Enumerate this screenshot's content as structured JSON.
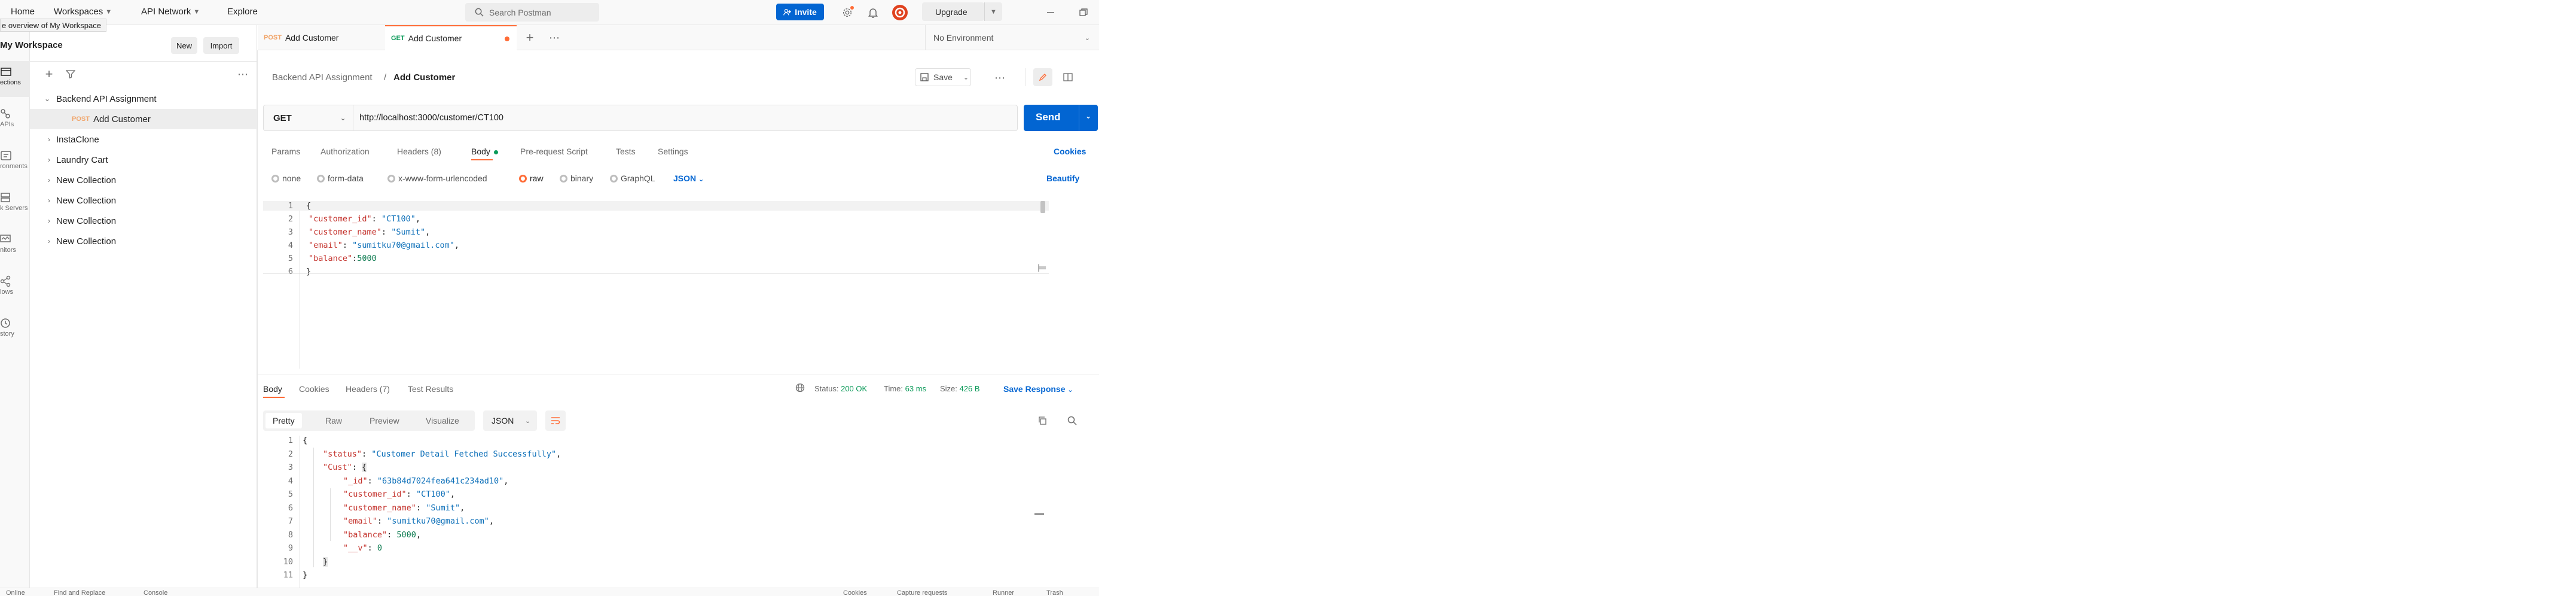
{
  "topbar": {
    "nav": [
      {
        "label": "Home",
        "has_menu": false
      },
      {
        "label": "Workspaces",
        "has_menu": true
      },
      {
        "label": "API Network",
        "has_menu": true
      },
      {
        "label": "Explore",
        "has_menu": false
      }
    ],
    "search_placeholder": "Search Postman",
    "invite_label": "Invite",
    "upgrade_label": "Upgrade",
    "tooltip": "e overview of My Workspace"
  },
  "rail": {
    "items": [
      {
        "label": "ections",
        "icon": "collections-icon",
        "active": true
      },
      {
        "label": "APIs",
        "icon": "apis-icon",
        "active": false
      },
      {
        "label": "ronments",
        "icon": "environments-icon",
        "active": false
      },
      {
        "label": "k Servers",
        "icon": "mock-servers-icon",
        "active": false
      },
      {
        "label": "nitors",
        "icon": "monitors-icon",
        "active": false
      },
      {
        "label": "lows",
        "icon": "flows-icon",
        "active": false
      },
      {
        "label": "story",
        "icon": "history-icon",
        "active": false
      }
    ]
  },
  "sidebar": {
    "workspace_name": "My Workspace",
    "new_label": "New",
    "import_label": "Import",
    "tree": [
      {
        "label": "Backend API Assignment",
        "expanded": true,
        "method": "",
        "selected": false
      },
      {
        "label": "Add Customer",
        "expanded": false,
        "method": "POST",
        "selected": true
      },
      {
        "label": "InstaClone",
        "expanded": false,
        "method": "",
        "selected": false
      },
      {
        "label": "Laundry Cart",
        "expanded": false,
        "method": "",
        "selected": false
      },
      {
        "label": "New Collection",
        "expanded": false,
        "method": "",
        "selected": false
      },
      {
        "label": "New Collection",
        "expanded": false,
        "method": "",
        "selected": false
      },
      {
        "label": "New Collection",
        "expanded": false,
        "method": "",
        "selected": false
      },
      {
        "label": "New Collection",
        "expanded": false,
        "method": "",
        "selected": false
      }
    ]
  },
  "tabs": [
    {
      "method": "POST",
      "label": "Add Customer",
      "active": false
    },
    {
      "method": "GET",
      "label": "Add Customer",
      "active": true
    }
  ],
  "environment": "No Environment",
  "request": {
    "breadcrumb_parent": "Backend API Assignment",
    "breadcrumb_sep": "/",
    "breadcrumb_current": "Add Customer",
    "save_label": "Save",
    "method": "GET",
    "url": "http://localhost:3000/customer/CT100",
    "send_label": "Send",
    "tabs": [
      {
        "label": "Params",
        "active": false
      },
      {
        "label": "Authorization",
        "active": false
      },
      {
        "label": "Headers (8)",
        "active": false
      },
      {
        "label": "Body",
        "active": true
      },
      {
        "label": "Pre-request Script",
        "active": false
      },
      {
        "label": "Tests",
        "active": false
      },
      {
        "label": "Settings",
        "active": false
      }
    ],
    "cookies_label": "Cookies",
    "body_types": [
      {
        "label": "none",
        "selected": false
      },
      {
        "label": "form-data",
        "selected": false
      },
      {
        "label": "x-www-form-urlencoded",
        "selected": false
      },
      {
        "label": "raw",
        "selected": true
      },
      {
        "label": "binary",
        "selected": false
      },
      {
        "label": "GraphQL",
        "selected": false
      }
    ],
    "body_format": "JSON",
    "beautify_label": "Beautify",
    "body_lines": [
      "1",
      "2",
      "3",
      "4",
      "5",
      "6"
    ]
  },
  "response": {
    "tabs": [
      {
        "label": "Body",
        "active": true
      },
      {
        "label": "Cookies",
        "active": false
      },
      {
        "label": "Headers (7)",
        "active": false
      },
      {
        "label": "Test Results",
        "active": false
      }
    ],
    "status_label": "Status:",
    "status_value": "200 OK",
    "time_label": "Time:",
    "time_value": "63 ms",
    "size_label": "Size:",
    "size_value": "426 B",
    "save_response_label": "Save Response",
    "view_modes": [
      {
        "label": "Pretty",
        "active": true
      },
      {
        "label": "Raw",
        "active": false
      },
      {
        "label": "Preview",
        "active": false
      },
      {
        "label": "Visualize",
        "active": false
      }
    ],
    "format": "JSON",
    "lines": [
      "1",
      "2",
      "3",
      "4",
      "5",
      "6",
      "7",
      "8",
      "9",
      "10",
      "11"
    ]
  },
  "statusbar": {
    "online": "Online",
    "console": "Console",
    "find_replace": "Find and Replace",
    "cookies": "Cookies",
    "capture": "Capture requests",
    "runner": "Runner",
    "trash": "Trash"
  },
  "colors": {
    "accent": "#ff6c37",
    "primary": "#0265d2",
    "status_ok": "#0b9a59",
    "json_key": "#c4332d",
    "json_string": "#0a6eb8",
    "json_number": "#0b7a4f"
  }
}
